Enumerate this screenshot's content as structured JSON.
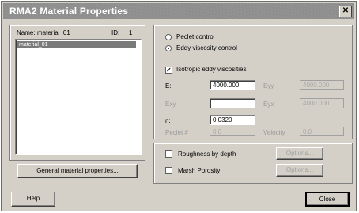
{
  "window": {
    "title": "RMA2 Material Properties",
    "close_glyph": "✕"
  },
  "left_panel": {
    "name_label": "Name:",
    "name_value": "material_01",
    "id_label": "ID:",
    "id_value": "1",
    "list_items": [
      "material_01"
    ],
    "general_button": "General material properties..."
  },
  "right_panel": {
    "peclet_control": "Peclet control",
    "eddy_control": "Eddy viscosity control",
    "isotropic": "Isotropic eddy viscosities",
    "fields": {
      "e_label": "E:",
      "e_value": "4000.000",
      "e2_label": "Eyy",
      "e2_value": "4000.000",
      "exy_label": "Exy",
      "eyx_label": "Eyx",
      "eyx_value": "4000.000",
      "n_label": "n:",
      "n_value": "0.0320",
      "peclet_label": "Peclet #",
      "peclet_value": "0.0",
      "velocity_label": "Velocity",
      "velocity_value": "0.0"
    },
    "roughness": "Roughness by depth",
    "roughness_button": "Options...",
    "marsh": "Marsh Porosity",
    "marsh_button": "Options..."
  },
  "footer": {
    "help": "Help",
    "close": "Close"
  }
}
